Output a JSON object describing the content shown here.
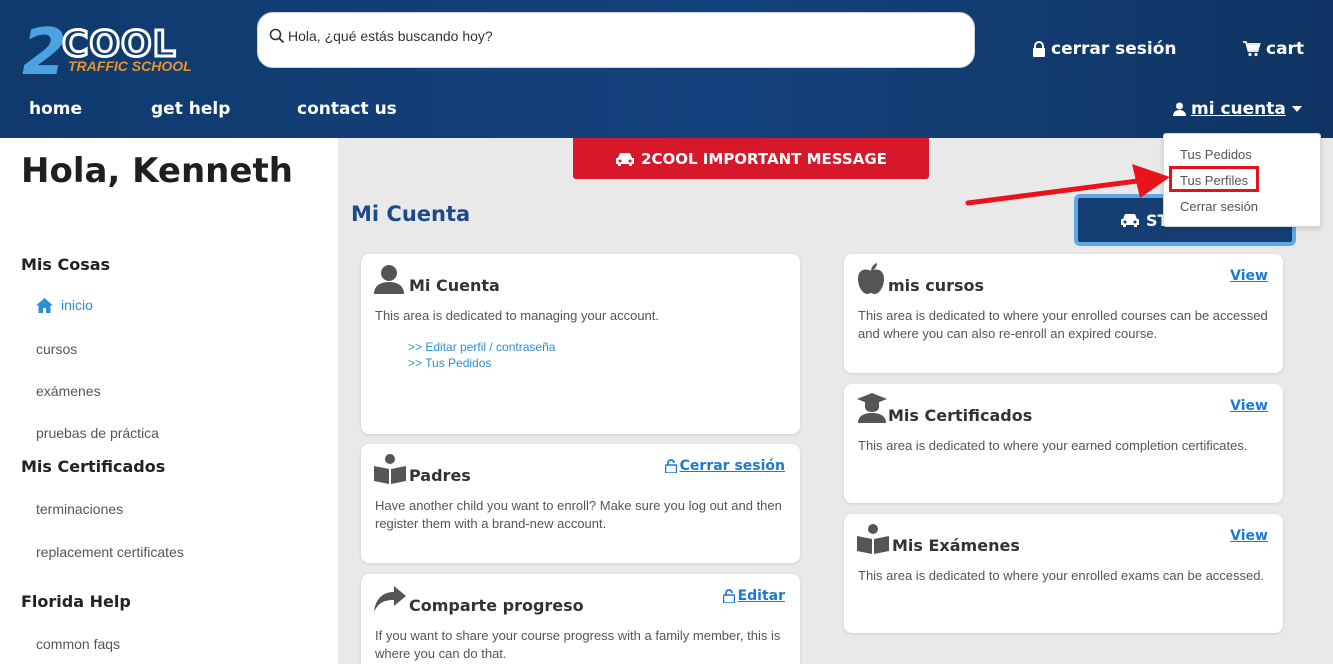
{
  "brand": {
    "logo_main": "2COOL",
    "logo_sub": "TRAFFIC SCHOOL",
    "accent": "#e8932a",
    "navy": "#14427c"
  },
  "search": {
    "placeholder": "Hola, ¿qué estás buscando hoy?"
  },
  "header": {
    "logout_label": "cerrar sesión",
    "cart_label": "cart",
    "nav": [
      "home",
      "get help",
      "contact us"
    ],
    "account_label": "mi cuenta"
  },
  "dropdown": {
    "items": [
      "Tus Pedidos",
      "Tus Perfiles",
      "Cerrar sesión"
    ],
    "highlighted": "Tus Perfiles"
  },
  "sidebar": {
    "greeting": "Hola, Kenneth",
    "sections": [
      {
        "title": "Mis Cosas",
        "items": [
          "inicio",
          "cursos",
          "exámenes",
          "pruebas de práctica"
        ]
      },
      {
        "title": "Mis Certificados",
        "items": [
          "terminaciones",
          "replacement certificates"
        ]
      },
      {
        "title": "Florida Help",
        "items": [
          "common faqs"
        ]
      }
    ]
  },
  "main": {
    "alert_label": "2COOL IMPORTANT MESSAGE",
    "title": "Mi Cuenta",
    "start_label": "ST",
    "cards": {
      "cuenta": {
        "title": "Mi Cuenta",
        "text": "This area is dedicated to managing your account.",
        "links": [
          ">> Editar perfil / contraseña",
          ">> Tus Pedidos"
        ]
      },
      "padres": {
        "title": "Padres",
        "link": "Cerrar sesión",
        "text": "Have another child you want to enroll? Make sure you log out and then register them with a brand-new account."
      },
      "comparte": {
        "title": "Comparte progreso",
        "link": "Editar",
        "text": "If you want to share your course progress with a family member, this is where you can do that."
      },
      "cursos": {
        "title": "mis cursos",
        "link": "View",
        "text": "This area is dedicated to where your enrolled courses can be accessed and where you can also re-enroll an expired course."
      },
      "certificados": {
        "title": "Mis Certificados",
        "link": "View",
        "text": "This area is dedicated to where your earned completion certificates."
      },
      "examenes": {
        "title": "Mis Exámenes",
        "link": "View",
        "text": "This area is dedicated to where your enrolled exams can be accessed."
      }
    }
  }
}
